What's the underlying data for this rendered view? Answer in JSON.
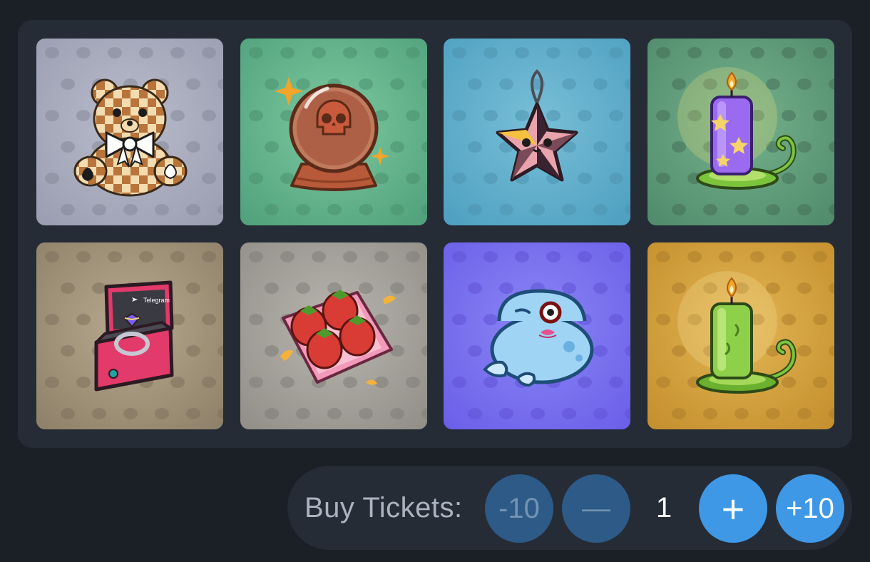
{
  "gifts": [
    {
      "name": "Teddy Bear",
      "icon": "checkered-teddy-bear-icon",
      "bg": [
        "#b9bccb",
        "#9a9db0"
      ],
      "pattern": "#868999"
    },
    {
      "name": "Crystal Ball",
      "icon": "skull-crystal-ball-icon",
      "bg": [
        "#7dc9a0",
        "#4fa07a"
      ],
      "pattern": "#4a9270"
    },
    {
      "name": "Star Ornament",
      "icon": "star-ornament-icon",
      "bg": [
        "#78bfd8",
        "#4d9fc0"
      ],
      "pattern": "#4f94b0"
    },
    {
      "name": "Purple Candle",
      "icon": "purple-candle-icon",
      "bg": [
        "#76b28c",
        "#4f8a6b"
      ],
      "pattern": "#456f58"
    },
    {
      "name": "Ring Box",
      "icon": "ring-box-icon",
      "bg": [
        "#b7a98e",
        "#8e8068"
      ],
      "pattern": "#7d715c"
    },
    {
      "name": "Strawberry Box",
      "icon": "strawberry-box-icon",
      "bg": [
        "#b8b5ae",
        "#918e88"
      ],
      "pattern": "#807d78"
    },
    {
      "name": "Blue Frog",
      "icon": "blue-frog-icon",
      "bg": [
        "#8a86f5",
        "#6a5ee8"
      ],
      "pattern": "#6052d6"
    },
    {
      "name": "Green Candle",
      "icon": "green-candle-icon",
      "bg": [
        "#e3b553",
        "#c48e2d"
      ],
      "pattern": "#ad7e2a"
    }
  ],
  "ring_box_brand": "Telegram",
  "controls": {
    "label": "Buy Tickets:",
    "minus_ten_label": "-10",
    "minus_label": "—",
    "quantity": "1",
    "plus_label": "+",
    "plus_ten_label": "+10"
  },
  "colors": {
    "accent": "#3f98e6",
    "accent_dim": "#2d5a86",
    "panel": "#252c36",
    "page": "#1b2027"
  }
}
